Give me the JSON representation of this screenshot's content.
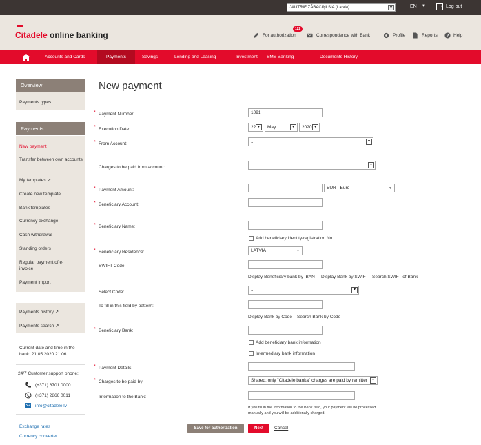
{
  "topbar": {
    "company": "JAUTRIE ZĀBACIŅI SIA (Latvia)",
    "language": "EN",
    "logout": "Log out"
  },
  "header": {
    "logo_brand": "Citadele",
    "logo_rest": " online banking",
    "auth_badge": "122",
    "links": {
      "authorization": "For authorization",
      "correspondence": "Correspondence with Bank",
      "profile": "Profile",
      "reports": "Reports",
      "help": "Help"
    }
  },
  "nav": {
    "items": [
      "Accounts and Cards",
      "Payments",
      "Savings",
      "Lending and Leasing",
      "Investment",
      "SMS Banking",
      "Documents History"
    ],
    "active": "Payments"
  },
  "sidebar": {
    "overview_title": "Overview",
    "overview_items": [
      "Payments types"
    ],
    "payments_title": "Payments",
    "payments_items": [
      "New payment",
      "Transfer between own accounts",
      "My templates ↗",
      "Create new template",
      "Bank templates",
      "Currency exchange",
      "Cash withdrawal",
      "Standing orders",
      "Regular payment of e-invoice",
      "Payment import"
    ],
    "extra_items": [
      "Payments history ↗",
      "Payments search ↗"
    ],
    "datetime_label": "Current date and time in the bank: 21.05.2020 21:06",
    "support_label": "24/7 Customer support phone:",
    "phone1": "(+371) 6701 0000",
    "phone2": "(+371) 2866 0011",
    "email": "info@citadele.lv",
    "links": [
      "Exchange rates",
      "Currency converter"
    ]
  },
  "form": {
    "title": "New payment",
    "payment_number_label": "Payment Number:",
    "payment_number": "1091",
    "execution_date_label": "Execution Date:",
    "date_day": "22",
    "date_month": "May",
    "date_year": "2020",
    "from_account_label": "From Account:",
    "from_account": "...",
    "charges_account_label": "Charges to be paid from account:",
    "charges_account": "...",
    "amount_label": "Payment Amount:",
    "currency": "EUR - Euro",
    "beneficiary_account_label": "Beneficiary Account:",
    "beneficiary_name_label": "Beneficiary Name:",
    "add_identity_label": "Add beneficiary identity/registration No.",
    "residence_label": "Beneficiary Residence:",
    "residence": "LATVIA",
    "swift_label": "SWIFT Code:",
    "swift_links": [
      "Display Beneficiary bank by IBAN",
      "Display Bank by SWIFT",
      "Search SWIFT of Bank"
    ],
    "select_code_label": "Select Code:",
    "select_code": "...",
    "pattern_label": "To fill in this field by pattern:",
    "code_links": [
      "Display Bank by Code",
      "Search Bank by Code"
    ],
    "beneficiary_bank_label": "Beneficiary Bank:",
    "add_bank_info_label": "Add beneficiary bank information",
    "intermediary_label": "Intermediary bank information",
    "details_label": "Payment Details:",
    "charges_by_label": "Charges to be paid by:",
    "charges_by": "Shared: only \"Citadele banka\" charges are paid by remitter",
    "info_label": "Information to the Bank:",
    "note": "If you fill in the Information to the Bank field, your payment will be processed manually and you will be additionally charged.",
    "save_button": "Save for authorization",
    "next_button": "Next",
    "cancel_link": "Cancel"
  },
  "colors": {
    "brand_red": "#e30b2b",
    "topbar": "#3c3533",
    "header_bg": "#ebe6df",
    "sidebar_head": "#8c8077",
    "save_button": "#8c8077"
  }
}
